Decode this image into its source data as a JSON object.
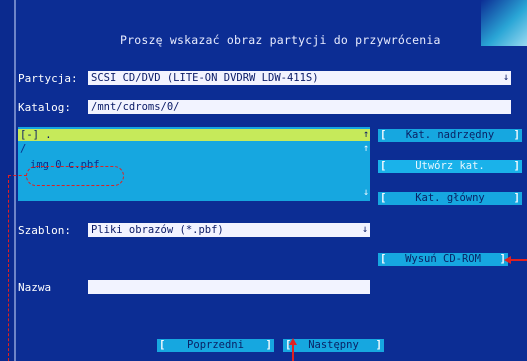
{
  "dialog": {
    "title": "Proszę wskazać obraz partycji do przywrócenia"
  },
  "partition": {
    "label": "Partycja:",
    "value": "SCSI CD/DVD (LITE-ON DVDRW LDW-411S)",
    "dropdown_glyph": "↓"
  },
  "catalog": {
    "label": "Katalog:",
    "value": "/mnt/cdroms/0/"
  },
  "file_list": {
    "items": [
      {
        "label": "[-] .",
        "selected": true,
        "arrow": "↑"
      },
      {
        "label": "/",
        "selected": false,
        "arrow": "↑"
      },
      {
        "label": "img 0 c.pbf",
        "selected": false,
        "arrow": ""
      }
    ],
    "scroll_down_glyph": "↓"
  },
  "side_buttons": {
    "parent_dir": "Kat. nadrzędny",
    "create_dir": "Utwórz kat.",
    "main_dir": "Kat. główny",
    "eject_cdrom": "Wysuń CD-ROM",
    "bracket_left": "[",
    "bracket_right": "]"
  },
  "template": {
    "label": "Szablon:",
    "value": "Pliki obrazów (*.pbf)",
    "dropdown_glyph": "↓"
  },
  "name": {
    "label": "Nazwa",
    "value": ""
  },
  "nav": {
    "previous": "Poprzedni",
    "next": "Następny",
    "bracket_left": "[",
    "bracket_right": "]"
  },
  "colors": {
    "background": "#0c2d94",
    "list_background": "#16a7e0",
    "selected_row": "#c6ea5a",
    "annotation": "#e02020"
  }
}
